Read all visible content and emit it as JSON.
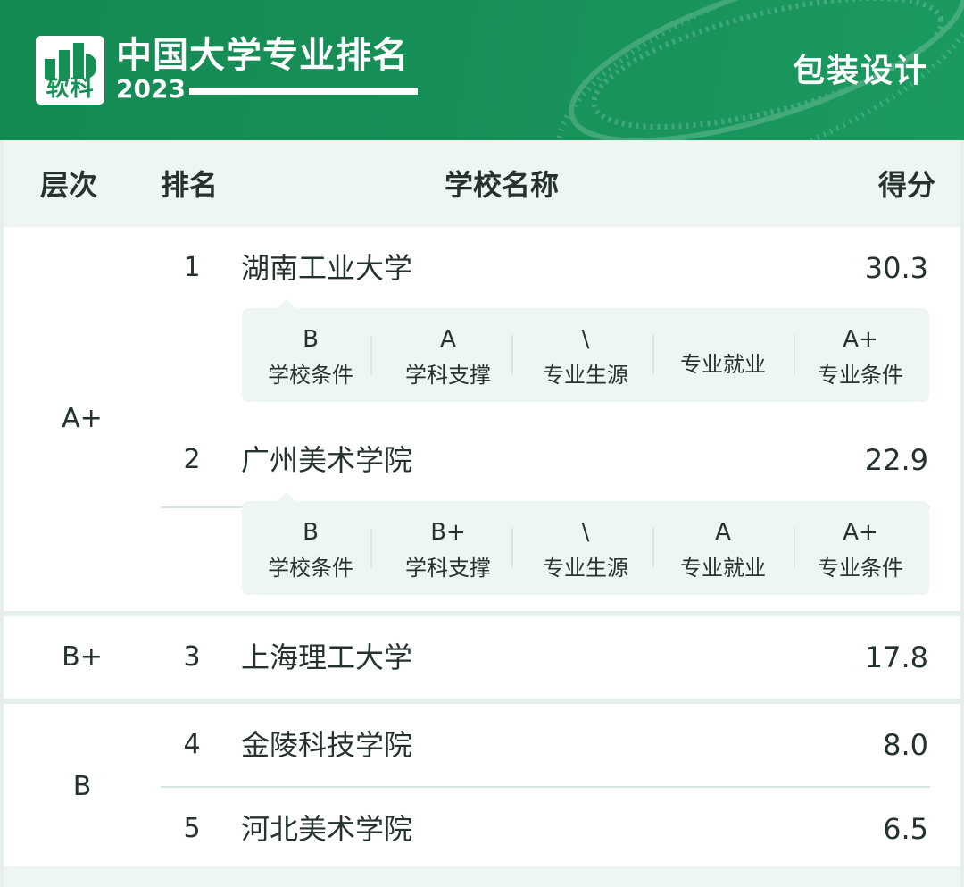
{
  "header": {
    "logo_text": "软科",
    "title": "中国大学专业排名",
    "year": "2023",
    "subject": "包装设计",
    "brand_color": "#179058"
  },
  "table": {
    "columns": [
      "层次",
      "排名",
      "学校名称",
      "得分"
    ],
    "groups": [
      {
        "tier": "A+",
        "rows": [
          {
            "rank": "1",
            "name": "湖南工业大学",
            "score": "30.3",
            "details": [
              {
                "grade": "B",
                "label": "学校条件"
              },
              {
                "grade": "A",
                "label": "学科支撑"
              },
              {
                "grade": "\\",
                "label": "专业生源"
              },
              {
                "grade": "",
                "label": "专业就业"
              },
              {
                "grade": "A+",
                "label": "专业条件"
              }
            ]
          },
          {
            "rank": "2",
            "name": "广州美术学院",
            "score": "22.9",
            "details": [
              {
                "grade": "B",
                "label": "学校条件"
              },
              {
                "grade": "B+",
                "label": "学科支撑"
              },
              {
                "grade": "\\",
                "label": "专业生源"
              },
              {
                "grade": "A",
                "label": "专业就业"
              },
              {
                "grade": "A+",
                "label": "专业条件"
              }
            ]
          }
        ]
      },
      {
        "tier": "B+",
        "rows": [
          {
            "rank": "3",
            "name": "上海理工大学",
            "score": "17.8"
          }
        ]
      },
      {
        "tier": "B",
        "rows": [
          {
            "rank": "4",
            "name": "金陵科技学院",
            "score": "8.0"
          },
          {
            "rank": "5",
            "name": "河北美术学院",
            "score": "6.5"
          }
        ]
      }
    ]
  }
}
